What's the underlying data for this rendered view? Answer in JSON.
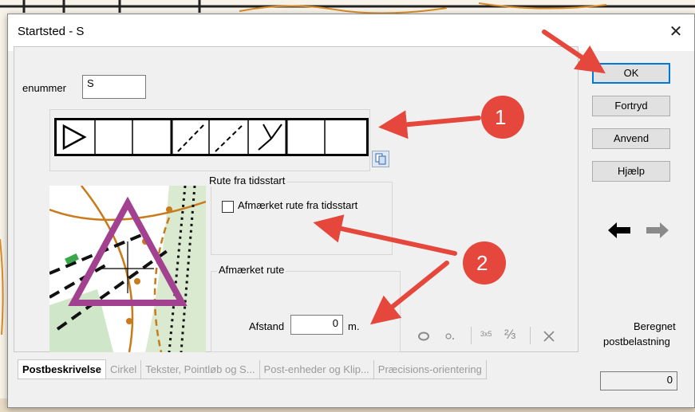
{
  "dialog": {
    "title": "Startsted - S",
    "close_symbol": "✕"
  },
  "control": {
    "number_label": "enummer",
    "number_value": "S"
  },
  "description_grid": {
    "cells": [
      "start-triangle",
      "",
      "",
      "dash-slash",
      "dash-slash",
      "y-junction",
      "",
      ""
    ]
  },
  "route_from_start": {
    "group_label": "Rute fra tidsstart",
    "checkbox_label": "Afmærket rute fra tidsstart",
    "checked": false
  },
  "marked_route": {
    "group_label": "Afmærket rute",
    "distance_label": "Afstand",
    "distance_value": "0",
    "unit": "m."
  },
  "buttons": {
    "ok": "OK",
    "cancel": "Fortryd",
    "apply": "Anvend",
    "help": "Hjælp"
  },
  "load": {
    "label_line1": "Beregnet",
    "label_line2": "postbelastning",
    "value": "0"
  },
  "tools": {
    "size_label": "3x5",
    "fraction_label": "⅔"
  },
  "tabs": [
    "Postbeskrivelse",
    "Cirkel",
    "Tekster, Pointløb og S...",
    "Post-enheder og Klip...",
    "Præcisions-orientering"
  ],
  "annotations": {
    "badge1": "1",
    "badge2": "2",
    "arrow_color": "#e5473d"
  }
}
